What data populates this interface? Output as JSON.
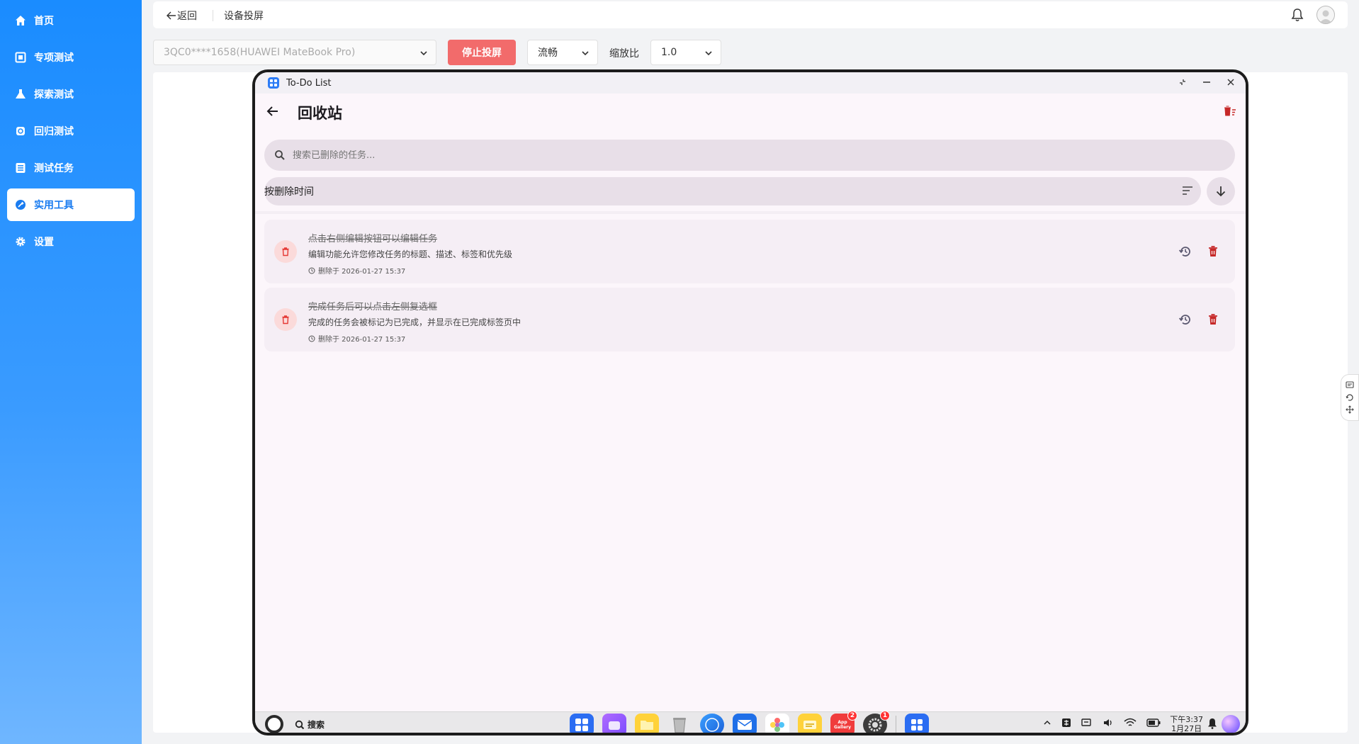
{
  "sidebar": {
    "items": [
      {
        "label": "首页",
        "icon": "home-icon"
      },
      {
        "label": "专项测试",
        "icon": "square-icon"
      },
      {
        "label": "探索测试",
        "icon": "flask-icon"
      },
      {
        "label": "回归测试",
        "icon": "refresh-icon"
      },
      {
        "label": "测试任务",
        "icon": "list-icon"
      },
      {
        "label": "实用工具",
        "icon": "tool-icon",
        "active": true
      },
      {
        "label": "设置",
        "icon": "gear-icon"
      }
    ]
  },
  "header": {
    "back_label": "返回",
    "page_title": "设备投屏"
  },
  "controls": {
    "device": "3QC0****1658(HUAWEI MateBook Pro)",
    "stop_label": "停止投屏",
    "quality": "流畅",
    "scale_label": "缩放比",
    "scale": "1.0"
  },
  "device_window": {
    "title": "To-Do List",
    "app": {
      "title": "回收站",
      "search_placeholder": "搜索已删除的任务...",
      "sort_label": "按删除时间",
      "tasks": [
        {
          "title": "点击右侧编辑按钮可以编辑任务",
          "description": "编辑功能允许您修改任务的标题、描述、标签和优先级",
          "deleted_at": "删除于 2026-01-27 15:37"
        },
        {
          "title": "完成任务后可以点击左侧复选框",
          "description": "完成的任务会被标记为已完成，并显示在已完成标签页中",
          "deleted_at": "删除于 2026-01-27 15:37"
        }
      ]
    },
    "taskbar": {
      "search_label": "搜索",
      "app_gallery_label": "App Gallery",
      "badges": {
        "app_gallery": "2",
        "settings": "1"
      },
      "time": "下午3:37",
      "date": "1月27日"
    }
  },
  "colors": {
    "sidebar_blue": "#1a8cff",
    "stop_red": "#f26b6b",
    "delete_red": "#c62828",
    "app_bg": "#fcf6fb"
  }
}
